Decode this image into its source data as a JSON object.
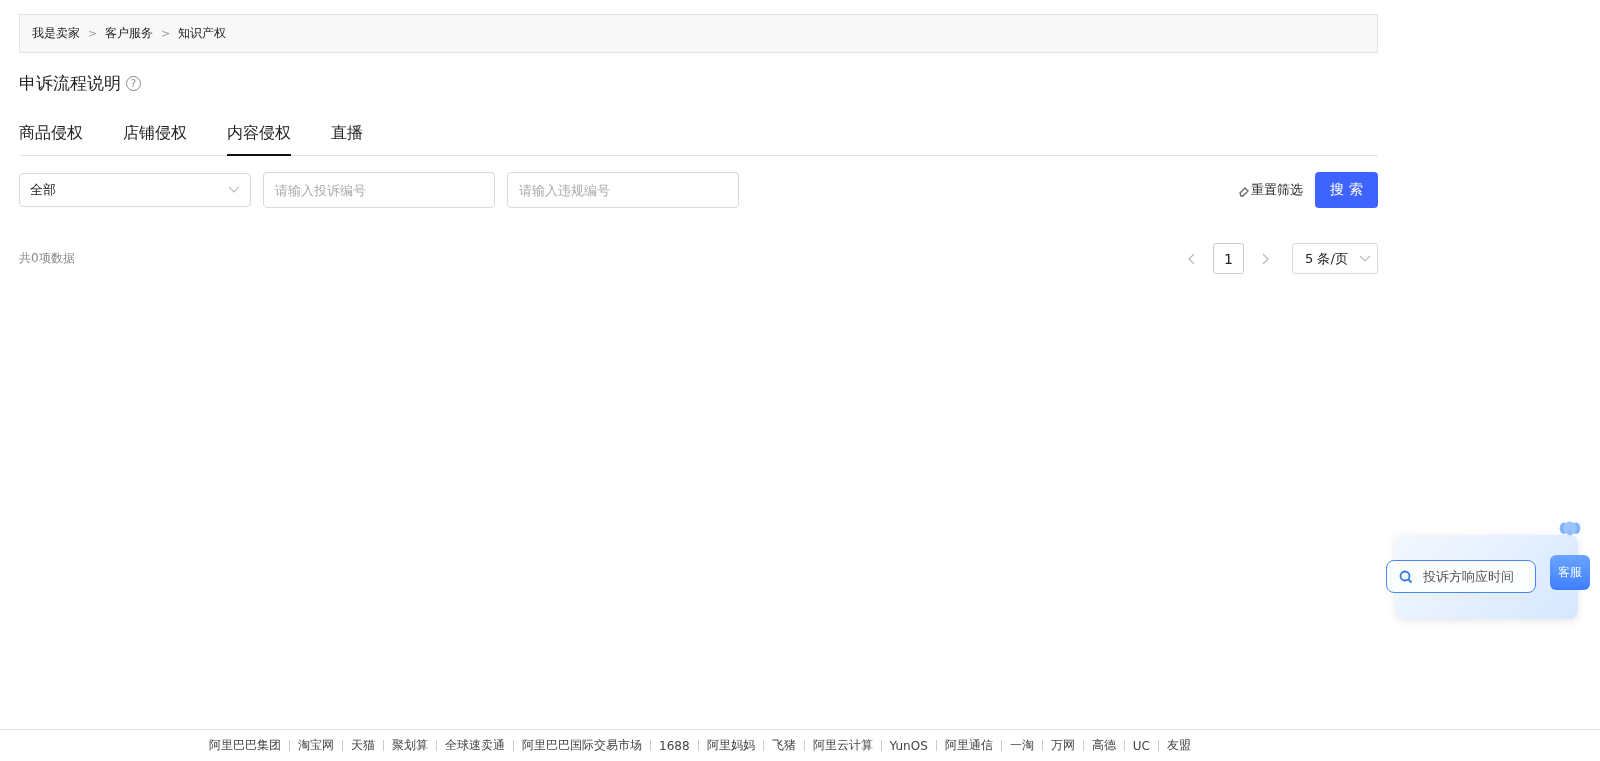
{
  "breadcrumb": [
    "我是卖家",
    "客户服务",
    "知识产权"
  ],
  "breadcrumb_separator": ">",
  "heading": {
    "title": "申诉流程说明",
    "help_icon": "?"
  },
  "tabs": [
    {
      "label": "商品侵权",
      "selected": false
    },
    {
      "label": "店铺侵权",
      "selected": false
    },
    {
      "label": "内容侵权",
      "selected": true
    },
    {
      "label": "直播",
      "selected": false
    }
  ],
  "filters": {
    "type_select": "全部",
    "complaint_field": {
      "placeholder": "请输入投诉编号"
    },
    "violation_field": {
      "placeholder": "请输入违规编号"
    },
    "reset": "重置筛选",
    "search_button": "搜 索"
  },
  "total": "共0项数据",
  "pagination": {
    "pages": [
      {
        "label": "1",
        "selected": true
      }
    ],
    "page_size": "5 条/页"
  },
  "assistant": {
    "search_hint": "投诉方响应时间",
    "service_label": "客服"
  },
  "footer_links": [
    "阿里巴巴集团",
    "淘宝网",
    "天猫",
    "聚划算",
    "全球速卖通",
    "阿里巴巴国际交易市场",
    "1688",
    "阿里妈妈",
    "飞猪",
    "阿里云计算",
    "YunOS",
    "阿里通信",
    "一淘",
    "万网",
    "高德",
    "UC",
    "友盟"
  ]
}
